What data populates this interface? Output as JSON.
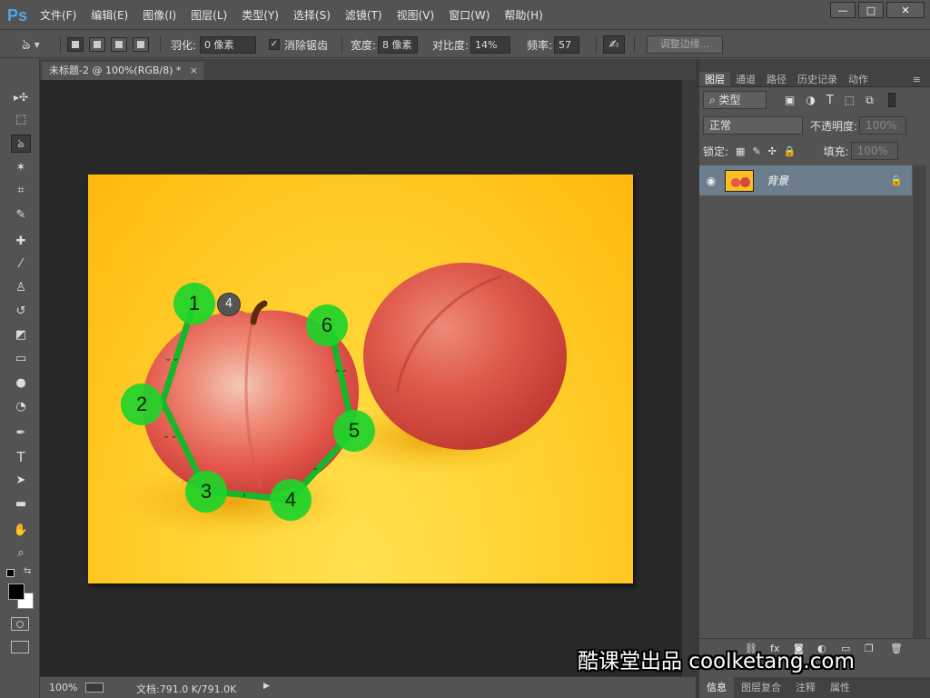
{
  "app": {
    "logo": "Ps"
  },
  "menu": [
    "文件(F)",
    "编辑(E)",
    "图像(I)",
    "图层(L)",
    "类型(Y)",
    "选择(S)",
    "滤镜(T)",
    "视图(V)",
    "窗口(W)",
    "帮助(H)"
  ],
  "window_buttons": {
    "minimize": "—",
    "restore": "□",
    "close": "✕"
  },
  "options": {
    "feather_label": "羽化:",
    "feather_value": "0 像素",
    "antialias_label": "消除锯齿",
    "antialias_checked": "✓",
    "width_label": "宽度:",
    "width_value": "8 像素",
    "contrast_label": "对比度:",
    "contrast_value": "14%",
    "frequency_label": "频率:",
    "frequency_value": "57",
    "refine_edge": "调整边缘..."
  },
  "document": {
    "tab_title": "未标题-2 @ 100%(RGB/8) *",
    "tab_close": "×",
    "zoom": "100%",
    "doc_size": "文档:791.0 K/791.0K",
    "arrow": "▶"
  },
  "tools": [
    {
      "name": "move-tool-icon",
      "glyph": "▸✣"
    },
    {
      "name": "marquee-tool-icon",
      "glyph": "⬚"
    },
    {
      "name": "magnetic-lasso-tool-icon",
      "glyph": "ঌ"
    },
    {
      "name": "magic-wand-tool-icon",
      "glyph": "✶"
    },
    {
      "name": "crop-tool-icon",
      "glyph": "⌗"
    },
    {
      "name": "eyedropper-tool-icon",
      "glyph": "✎"
    },
    {
      "name": "healing-brush-tool-icon",
      "glyph": "✚"
    },
    {
      "name": "brush-tool-icon",
      "glyph": "⁄"
    },
    {
      "name": "clone-stamp-tool-icon",
      "glyph": "♙"
    },
    {
      "name": "history-brush-tool-icon",
      "glyph": "↺"
    },
    {
      "name": "eraser-tool-icon",
      "glyph": "◩"
    },
    {
      "name": "gradient-tool-icon",
      "glyph": "▭"
    },
    {
      "name": "blur-tool-icon",
      "glyph": "●"
    },
    {
      "name": "dodge-tool-icon",
      "glyph": "◔"
    },
    {
      "name": "pen-tool-icon",
      "glyph": "✒"
    },
    {
      "name": "type-tool-icon",
      "glyph": "T"
    },
    {
      "name": "path-selection-tool-icon",
      "glyph": "➤"
    },
    {
      "name": "rectangle-tool-icon",
      "glyph": "▬"
    },
    {
      "name": "hand-tool-icon",
      "glyph": "✋"
    },
    {
      "name": "zoom-tool-icon",
      "glyph": "⌕"
    }
  ],
  "tutorial_markers": [
    {
      "label": "1"
    },
    {
      "label": "2"
    },
    {
      "label": "3"
    },
    {
      "label": "4"
    },
    {
      "label": "5"
    },
    {
      "label": "6"
    }
  ],
  "cursor_badge": "4",
  "layers_panel": {
    "tabs": [
      "图层",
      "通道",
      "路径",
      "历史记录",
      "动作"
    ],
    "filter_kind": "⌕ 类型",
    "blend_mode": "正常",
    "opacity_label": "不透明度:",
    "opacity_value": "100%",
    "lock_label": "锁定:",
    "fill_label": "填充:",
    "fill_value": "100%",
    "layer_name": "背景",
    "eye": "👁",
    "lock": "🔒"
  },
  "bottom_tabs": [
    "信息",
    "图层复合",
    "注释",
    "属性"
  ],
  "watermark": "酷课堂出品 coolketang.com",
  "colors": {
    "accent_green": "#1fd42a",
    "path_green": "#19b52a",
    "ps_blue": "#4fa6e8",
    "selected_layer": "#6c7d8e"
  }
}
